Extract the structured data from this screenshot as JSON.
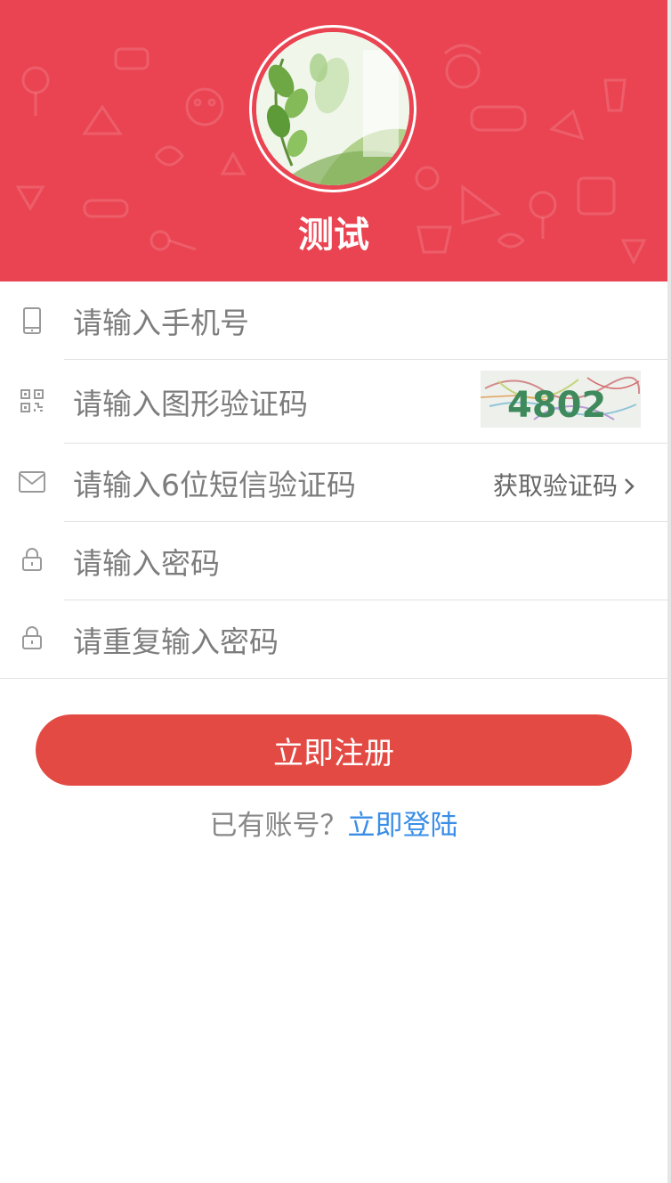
{
  "header": {
    "title": "测试",
    "background_color": "#ea4452",
    "avatar_icon": "avatar-leaf-illustration"
  },
  "form": {
    "phone": {
      "placeholder": "请输入手机号",
      "icon": "phone-icon"
    },
    "captcha": {
      "placeholder": "请输入图形验证码",
      "icon": "qrcode-icon",
      "captcha_text": "4802"
    },
    "sms": {
      "placeholder": "请输入6位短信验证码",
      "icon": "mail-icon",
      "link_label": "获取验证码"
    },
    "password": {
      "placeholder": "请输入密码",
      "icon": "lock-icon"
    },
    "password_repeat": {
      "placeholder": "请重复输入密码",
      "icon": "lock-icon"
    }
  },
  "actions": {
    "submit_label": "立即注册",
    "submit_color": "#e34a44",
    "login_prompt": "已有账号？",
    "login_link": "立即登陆",
    "link_color": "#3a8ee6"
  }
}
